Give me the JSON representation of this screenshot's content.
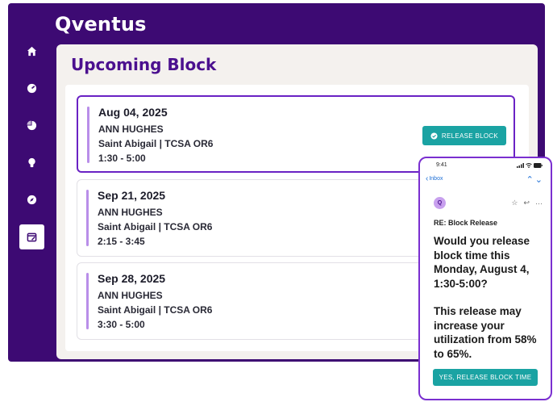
{
  "app": {
    "logo": "Qventus"
  },
  "nav": {
    "items": [
      {
        "icon": "home-icon",
        "active": false
      },
      {
        "icon": "gauge-icon",
        "active": false
      },
      {
        "icon": "pie-chart-icon",
        "active": false
      },
      {
        "icon": "lightbulb-icon",
        "active": false
      },
      {
        "icon": "compass-icon",
        "active": false
      },
      {
        "icon": "calendar-edit-icon",
        "active": true
      }
    ]
  },
  "page": {
    "title": "Upcoming Block"
  },
  "blocks": [
    {
      "date": "Aug 04, 2025",
      "surgeon": "ANN HUGHES",
      "location": "Saint Abigail | TCSA OR6",
      "time": "1:30 - 5:00",
      "selected": true
    },
    {
      "date": "Sep 21, 2025",
      "surgeon": "ANN HUGHES",
      "location": "Saint Abigail | TCSA OR6",
      "time": "2:15 - 3:45",
      "selected": false
    },
    {
      "date": "Sep 28, 2025",
      "surgeon": "ANN HUGHES",
      "location": "Saint Abigail | TCSA OR6",
      "time": "3:30 - 5:00",
      "selected": false
    }
  ],
  "release_button": {
    "label": "RELEASE BLOCK"
  },
  "phone": {
    "clock": "9:41",
    "back_label": "Inbox",
    "avatar_letter": "Q",
    "subject": "RE: Block Release",
    "message_1": "Would you release block time this Monday, August 4, 1:30-5:00?",
    "message_2": "This release may increase your utilization from 58% to 65%.",
    "confirm_label": "YES, RELEASE BLOCK TIME"
  },
  "colors": {
    "brand_purple": "#3d0a73",
    "title_purple": "#4b108f",
    "accent_teal": "#1aa3a3",
    "block_bar": "#b98ee9"
  }
}
